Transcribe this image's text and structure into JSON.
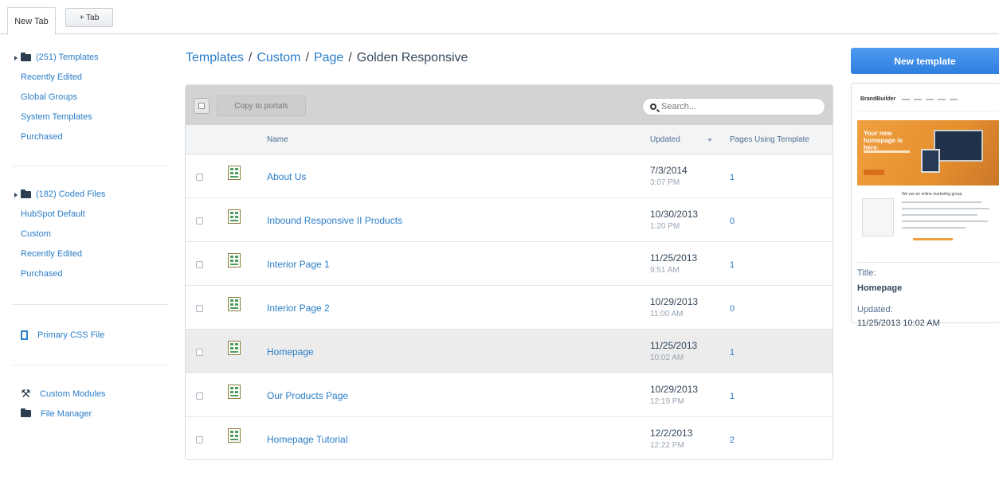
{
  "tabs": {
    "active_label": "New Tab",
    "add_label": "+ Tab"
  },
  "sidebar": {
    "templates_header": "(251) Templates",
    "template_links": [
      "Recently Edited",
      "Global Groups",
      "System Templates",
      "Purchased"
    ],
    "coded_header": "(182) Coded Files",
    "coded_links": [
      "HubSpot Default",
      "Custom",
      "Recently Edited",
      "Purchased"
    ],
    "primary_css": "Primary CSS File",
    "custom_modules": "Custom Modules",
    "file_manager": "File Manager"
  },
  "breadcrumb": {
    "items": [
      "Templates",
      "Custom",
      "Page"
    ],
    "separator": "/",
    "current": "Golden Responsive"
  },
  "toolbar": {
    "copy_label": "Copy to portals",
    "search_placeholder": "Search..."
  },
  "table": {
    "headers": {
      "name": "Name",
      "updated": "Updated",
      "pages": "Pages Using Template"
    },
    "rows": [
      {
        "name": "About Us",
        "date": "7/3/2014",
        "time": "3:07 PM",
        "count": "1"
      },
      {
        "name": "Inbound Responsive II Products",
        "date": "10/30/2013",
        "time": "1:20 PM",
        "count": "0"
      },
      {
        "name": "Interior Page 1",
        "date": "11/25/2013",
        "time": "9:51 AM",
        "count": "1"
      },
      {
        "name": "Interior Page 2",
        "date": "10/29/2013",
        "time": "11:00 AM",
        "count": "0"
      },
      {
        "name": "Homepage",
        "date": "11/25/2013",
        "time": "10:02 AM",
        "count": "1"
      },
      {
        "name": "Our Products Page",
        "date": "10/29/2013",
        "time": "12:19 PM",
        "count": "1"
      },
      {
        "name": "Homepage Tutorial",
        "date": "12/2/2013",
        "time": "12:22 PM",
        "count": "2"
      }
    ],
    "highlighted_row": 4
  },
  "preview": {
    "new_button": "New template",
    "thumb_logo_a": "Brand",
    "thumb_logo_b": "Builder",
    "thumb_hero": "Your new homepage is here.",
    "thumb_section_title": "We are an online marketing group.",
    "title_label": "Title:",
    "title_value": "Homepage",
    "updated_label": "Updated:",
    "updated_value": "11/25/2013 10:02 AM"
  },
  "colors": {
    "link": "#2a7dc7",
    "primary_button": "#3a8de8",
    "toolbar_bg": "#d3d3d3",
    "row_highlight": "#ececec"
  }
}
